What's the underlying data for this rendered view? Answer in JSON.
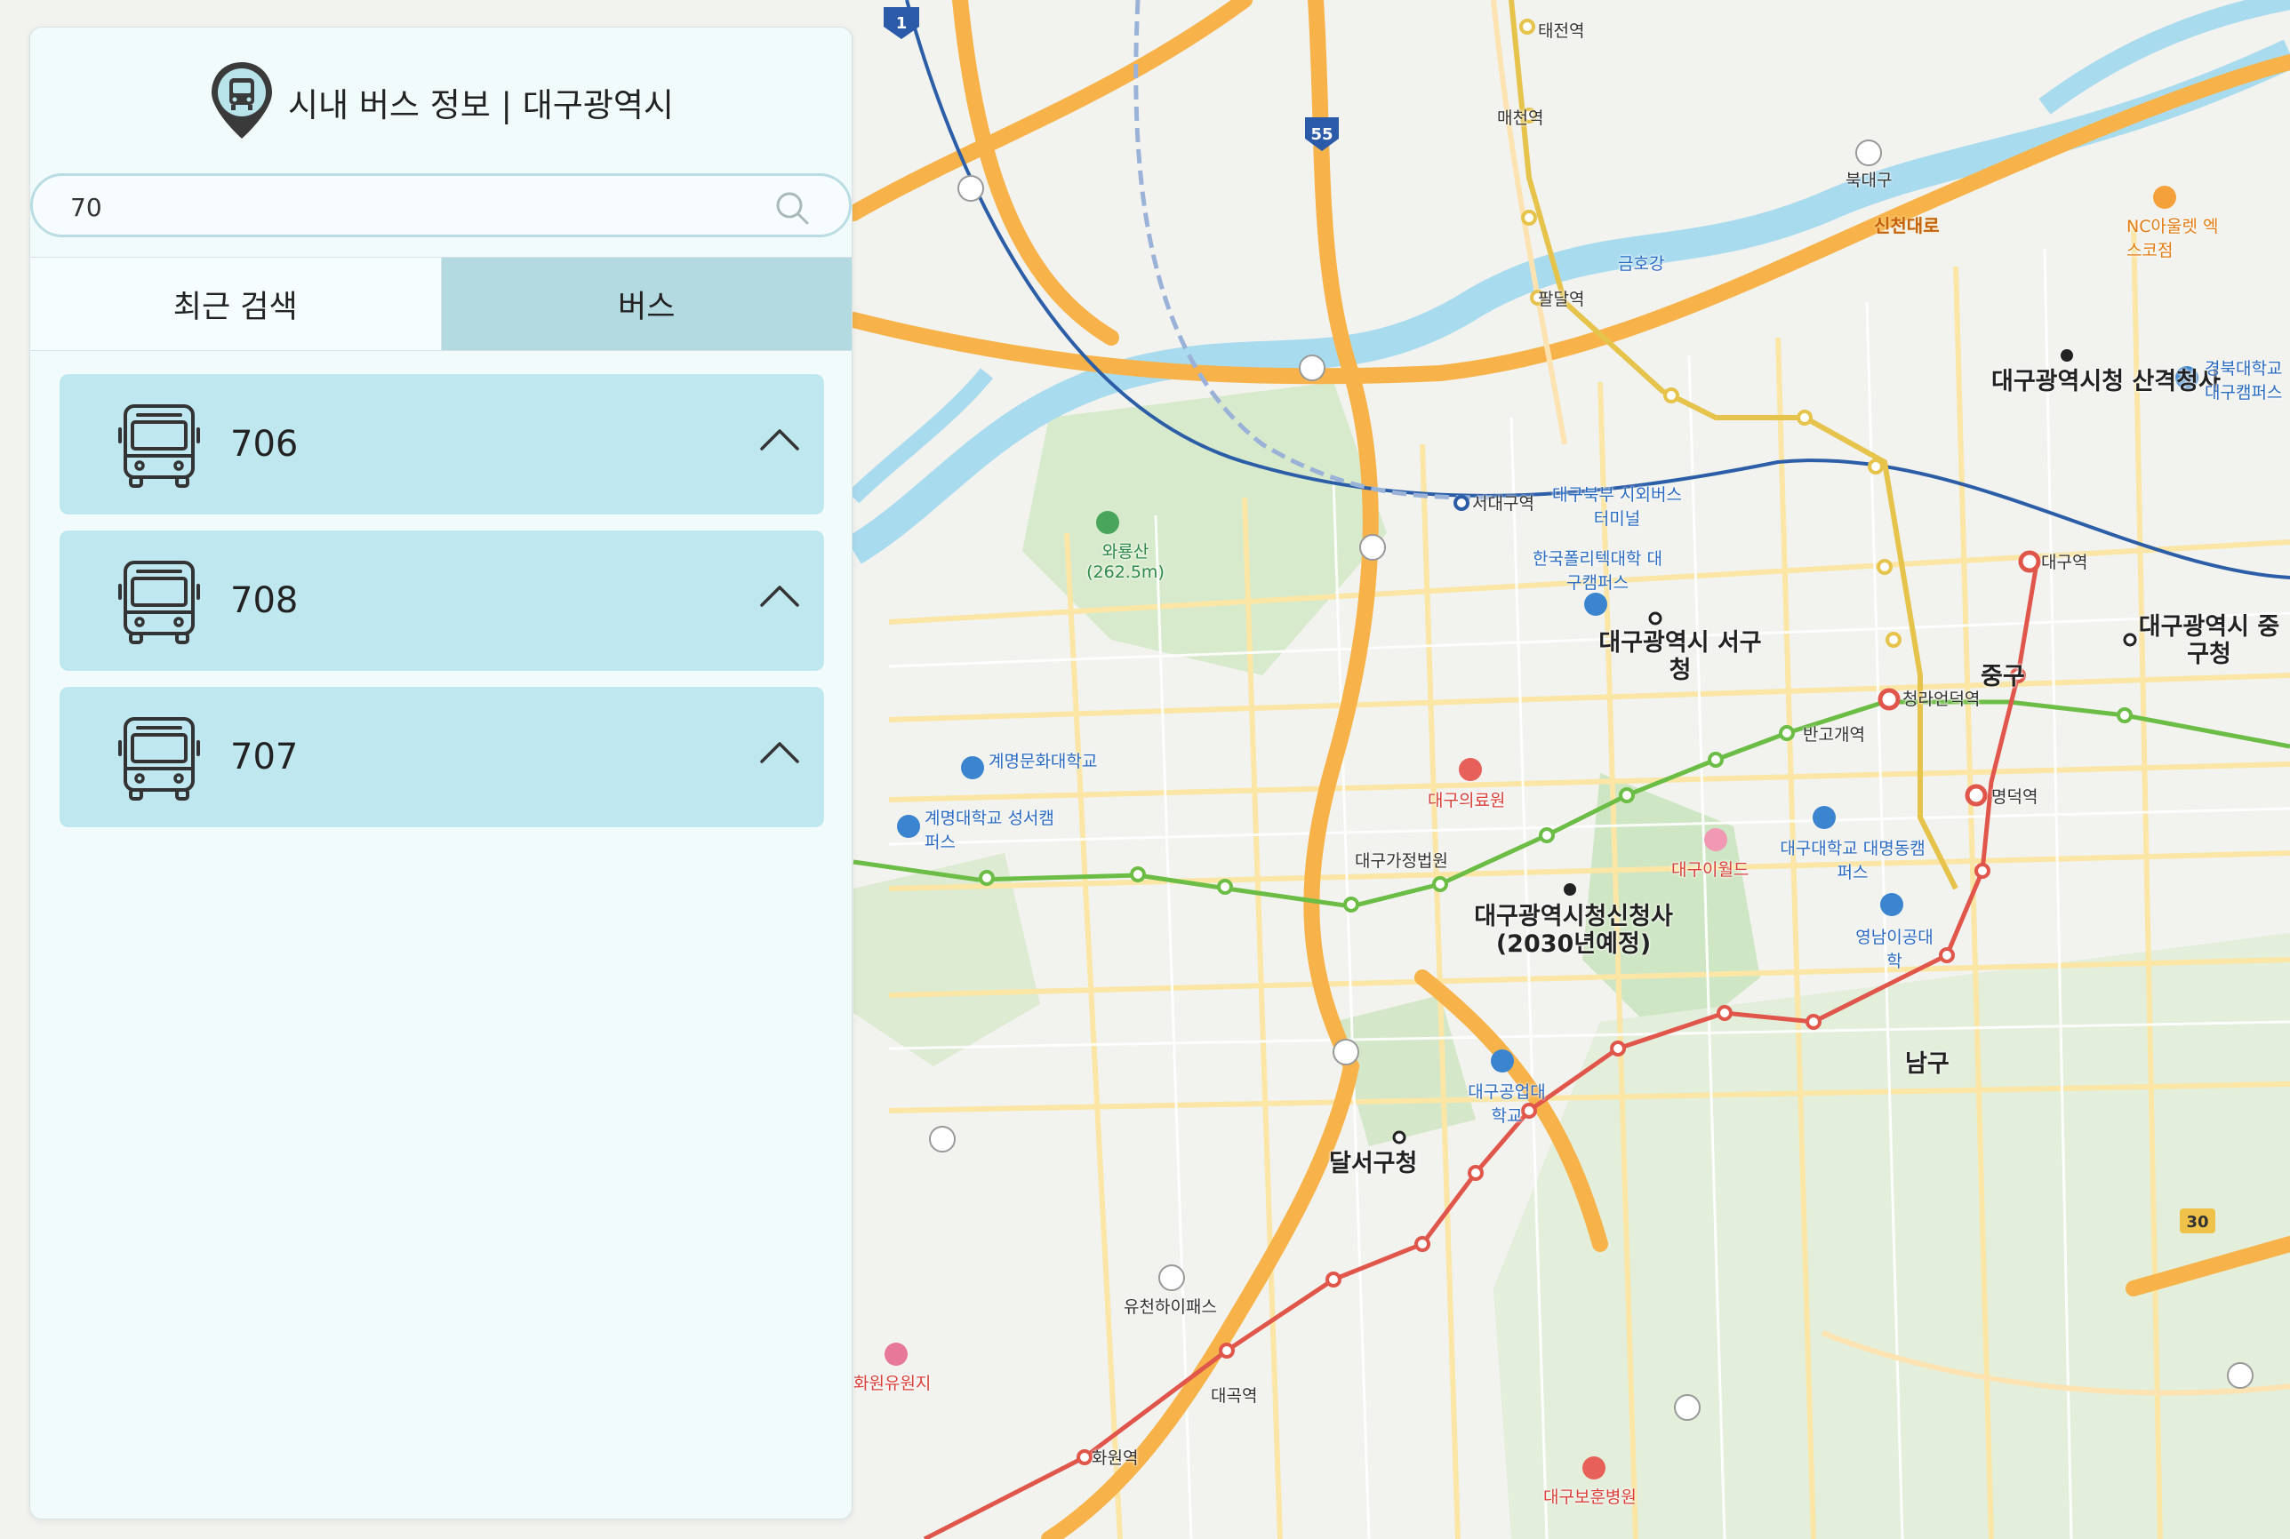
{
  "app": {
    "title": "시내 버스 정보 | 대구광역시",
    "logo_icon": "bus-pin-icon"
  },
  "search": {
    "value": "70",
    "icon": "search-icon"
  },
  "tabs": [
    {
      "label": "최근 검색",
      "active": false
    },
    {
      "label": "버스",
      "active": true
    }
  ],
  "results": [
    {
      "route": "706",
      "icon": "bus-icon",
      "expand_icon": "chevron-up-icon"
    },
    {
      "route": "708",
      "icon": "bus-icon",
      "expand_icon": "chevron-up-icon"
    },
    {
      "route": "707",
      "icon": "bus-icon",
      "expand_icon": "chevron-up-icon"
    }
  ],
  "map": {
    "labels": {
      "daegu_city_hall_sangyeok": "대구광역시청 산격청사",
      "seogu_office": "대구광역시 서구청",
      "junggu_office": "대구광역시 중구청",
      "new_city_hall": "대구광역시청신청사 (2030년예정)",
      "dalseo_office": "달서구청",
      "junggu": "중구",
      "namgu": "남구",
      "waryongsan": "와룡산 (262.5m)",
      "daegu_station": "대구역",
      "seodaegu_station": "서대구역",
      "banwoldang": "반고개역",
      "myeongdeok": "명덕역",
      "cheongna": "청라언덕역",
      "dongdaegu_hospital": "대구의료원",
      "keimyung_univ": "계명문화대학교",
      "keimyung_seongseo": "계명대학교 성서캠퍼스",
      "daegu_univ": "대구대학교 대명동캠퍼스",
      "yeungnam_ieng": "영남이공대학",
      "daegu_court": "대구가정법원",
      "ewha_world": "대구이월드",
      "geumhogang": "금호강",
      "sincheon": "신천대로",
      "nc_outlet": "NC아울렛 엑스코점",
      "yuchon_ic": "유천하이패스",
      "daegok": "대곡역",
      "hwawon": "화원역",
      "hwawon_resort": "화원유원지",
      "daegu_veterans": "대구보훈병원",
      "gyeongbuk_univ": "경북대학교 대구캠퍼스",
      "palda": "팔달역",
      "maecheon": "매천역",
      "taejeon": "태전역",
      "gukdaegu": "북대구",
      "daegu_polytech": "한국폴리텍대학 대구캠퍼스",
      "bukbu_terminal": "대구북부 시외버스터미널",
      "daegu_tech": "대구공업대학교"
    },
    "road_shields": [
      "1",
      "55",
      "30"
    ],
    "colors": {
      "line1": "#d9403a",
      "line2": "#6cbd45",
      "line3": "#e6b722",
      "highway": "#f7b34a",
      "river": "#9fd4ec",
      "park": "#cfe6c4"
    }
  }
}
